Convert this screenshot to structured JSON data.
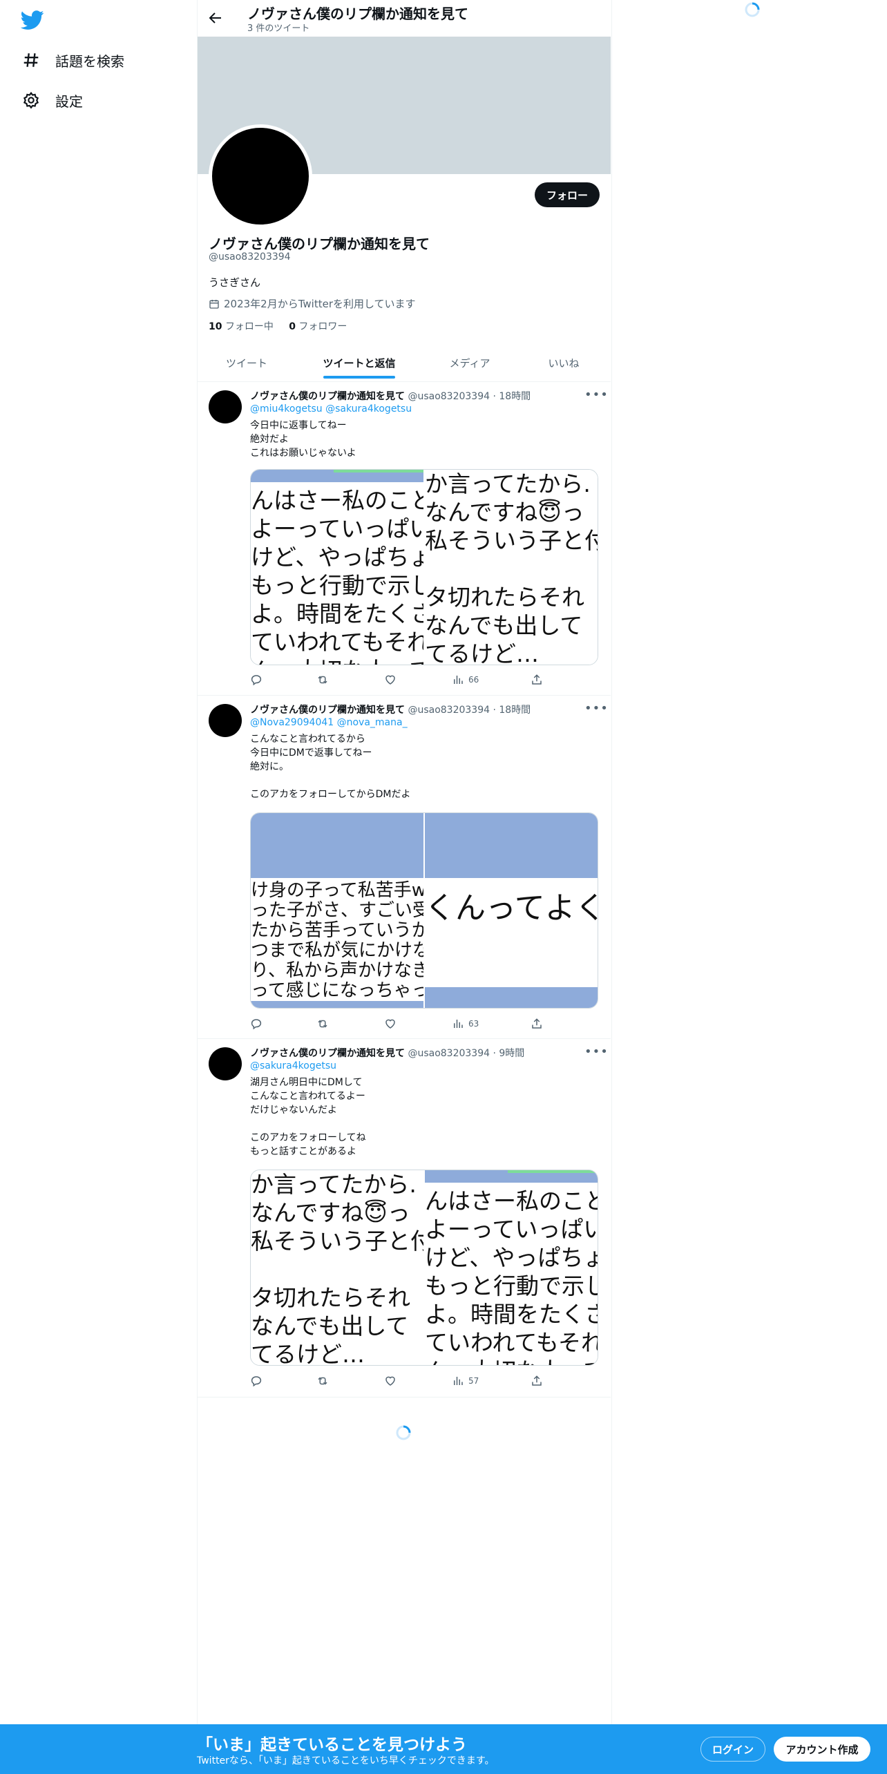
{
  "sidebar": {
    "logo_icon": "twitter-bird-icon",
    "items": [
      {
        "label": "話題を検索",
        "icon": "hashtag-icon"
      },
      {
        "label": "設定",
        "icon": "gear-icon"
      }
    ]
  },
  "header": {
    "title": "ノヴァさん僕のリプ欄か通知を見て",
    "tweet_count": "3 件のツイート"
  },
  "profile": {
    "name": "ノヴァさん僕のリプ欄か通知を見て",
    "handle": "@usao83203394",
    "bio": "うさぎさん",
    "joined": "2023年2月からTwitterを利用しています",
    "following_count": "10",
    "following_label": "フォロー中",
    "followers_count": "0",
    "followers_label": "フォロワー",
    "follow_button": "フォロー"
  },
  "tabs": [
    {
      "label": "ツイート",
      "active": false
    },
    {
      "label": "ツイートと返信",
      "active": true
    },
    {
      "label": "メディア",
      "active": false
    },
    {
      "label": "いいね",
      "active": false
    }
  ],
  "tweets": [
    {
      "name": "ノヴァさん僕のリプ欄か通知を見て",
      "meta": "@usao83203394 · 18時間",
      "reply_to": "@miu4kogetsu @sakura4kogetsu",
      "body": "今日中に返事してねー\n絶対だよ\nこれはお願いじゃないよ",
      "media": [
        "んはさー私のこと大\nよーっていっぱい言\nけど、やっぱちょっ\nもっと行動で示して\nよ。時間をたくさん\nていわれてもそれっ\nん。大切な人って思",
        "か言ってたから.\nなんですね😇っ\n私そういう子と付\n\nタ切れたらそれ\nなんでも出して\nてるけど…"
      ],
      "views": "66"
    },
    {
      "name": "ノヴァさん僕のリプ欄か通知を見て",
      "meta": "@usao83203394 · 18時間",
      "reply_to": "@Nova29094041 @nova_mana_",
      "body": "こんなこと言われてるから\n今日中にDMで返事してねー\n絶対に。\n\nこのアカをフォローしてからDMだよ",
      "media": [
        "け身の子って私苦手wトラ\nった子がさ、すごい受け身\nたから苦手っていうか大嫌\nつまで私が気にかけなきゃ\nり、私から声かけなきゃい\nって感じになっちゃってる",
        "くんってよく"
      ],
      "views": "63"
    },
    {
      "name": "ノヴァさん僕のリプ欄か通知を見て",
      "meta": "@usao83203394 · 9時間",
      "reply_to": "@sakura4kogetsu",
      "body": "湖月さん明日中にDMして\nこんなこと言われてるよー\nだけじゃないんだよ\n\nこのアカをフォローしてね\nもっと話すことがあるよ",
      "media": [
        "か言ってたから.\nなんですね😇っ\n私そういう子と付\n\nタ切れたらそれ\nなんでも出して\nてるけど…",
        "んはさー私のこと大\nよーっていっぱい言\nけど、やっぱちょっ\nもっと行動で示して\nよ。時間をたくさん\nていわれてもそれっ\nん。大切な人って思"
      ],
      "views": "57"
    }
  ],
  "bottom_bar": {
    "title": "「いま」起きていることを見つけよう",
    "subtitle": "Twitterなら、「いま」起きていることをいち早くチェックできます。",
    "login": "ログイン",
    "signup": "アカウント作成"
  },
  "colors": {
    "accent": "#1d9bf0",
    "banner": "#cfd9de",
    "media_bar": "#8eabda"
  }
}
